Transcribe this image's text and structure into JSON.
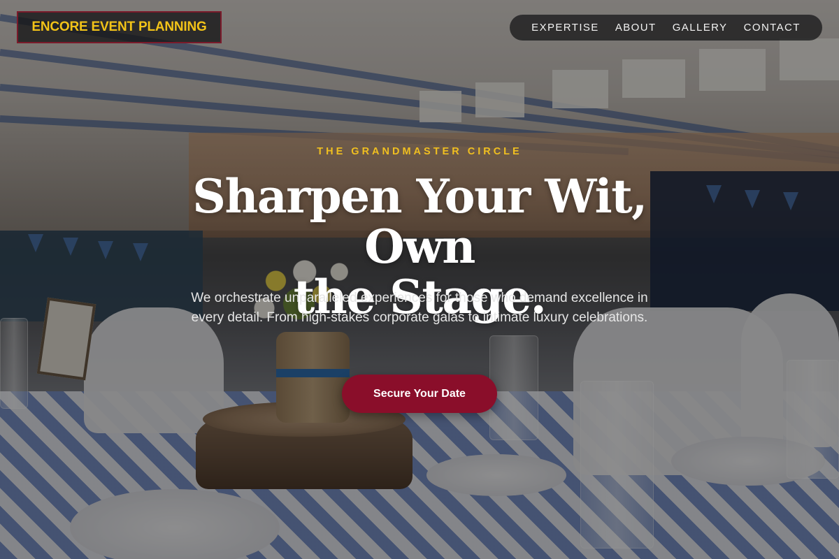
{
  "brand": {
    "name": "ENCORE EVENT PLANNING",
    "text_color": "#f2c318",
    "border_color": "#7a1a2a"
  },
  "nav": {
    "items": [
      {
        "label": "EXPERTISE"
      },
      {
        "label": "ABOUT"
      },
      {
        "label": "GALLERY"
      },
      {
        "label": "CONTACT"
      }
    ]
  },
  "hero": {
    "eyebrow": "THE GRANDMASTER CIRCLE",
    "headline_line1": "Sharpen Your Wit, Own",
    "headline_line2": "the Stage.",
    "subtext": "We orchestrate unparalleled experiences for those who demand excellence in every detail. From high-stakes corporate galas to intimate luxury celebrations.",
    "cta_label": "Secure Your Date",
    "eyebrow_color": "#f0bf20",
    "cta_color": "#8a0e2a"
  }
}
